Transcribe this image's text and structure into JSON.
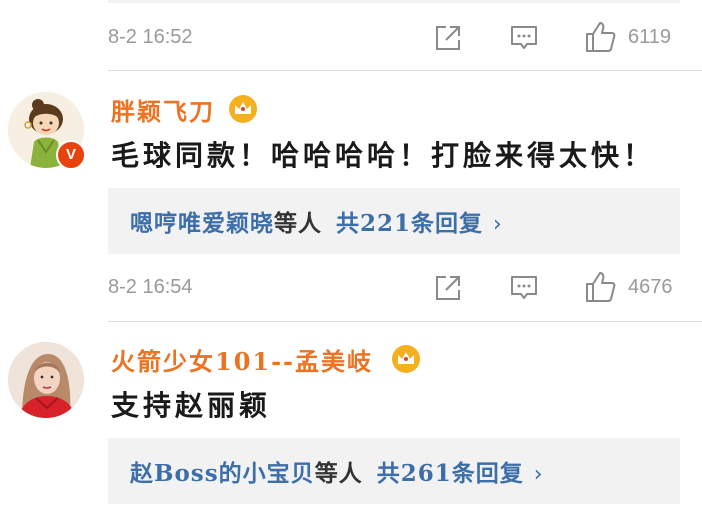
{
  "prev_comment": {
    "time": "8-2 16:52",
    "likes": "6119"
  },
  "comments": [
    {
      "username": "胖颖飞刀",
      "verified_badge": "V",
      "text": "毛球同款！哈哈哈哈！打脸来得太快！",
      "replies": {
        "users": "嗯哼唯爱颖晓",
        "suffix": "等人",
        "total": "共221条回复",
        "chevron": "›"
      },
      "time": "8-2 16:54",
      "likes": "4676"
    },
    {
      "username": "火箭少女101--孟美岐",
      "text": "支持赵丽颖",
      "replies": {
        "users": "赵Boss的小宝贝",
        "suffix": "等人",
        "total": "共261条回复",
        "chevron": "›"
      }
    }
  ],
  "icons": {
    "share": "share-icon",
    "comment": "comment-icon",
    "like": "thumbs-up-icon",
    "crown": "crown-badge-icon",
    "verified": "verified-badge-icon"
  },
  "colors": {
    "username": "#eb7322",
    "link": "#3c6eaa",
    "meta": "#9a9a9a",
    "reply_bg": "#f2f2f2",
    "verified": "#e8420e"
  }
}
